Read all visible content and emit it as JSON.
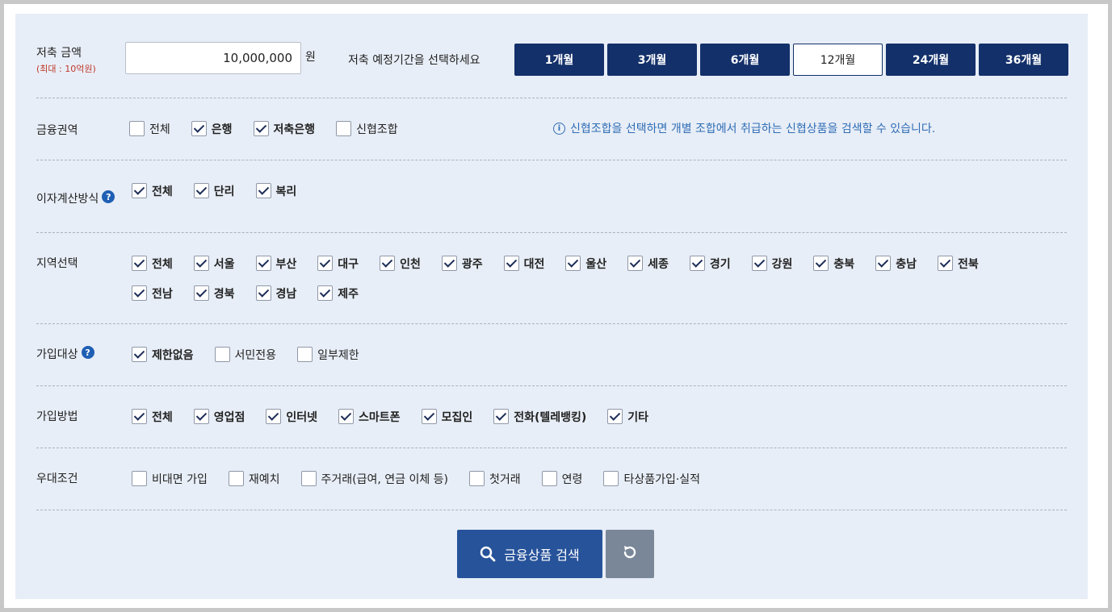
{
  "amount": {
    "label": "저축 금액",
    "sublabel": "(최대 : 10억원)",
    "value": "10,000,000",
    "unit": "원"
  },
  "period": {
    "label": "저축 예정기간을 선택하세요",
    "options": [
      "1개월",
      "3개월",
      "6개월",
      "12개월",
      "24개월",
      "36개월"
    ],
    "selected": "12개월"
  },
  "sector": {
    "label": "금융권역",
    "options": [
      {
        "label": "전체",
        "checked": false
      },
      {
        "label": "은행",
        "checked": true
      },
      {
        "label": "저축은행",
        "checked": true
      },
      {
        "label": "신협조합",
        "checked": false
      }
    ],
    "info": "신협조합을 선택하면 개별 조합에서 취급하는 신협상품을 검색할 수 있습니다."
  },
  "interest": {
    "label": "이자계산방식",
    "options": [
      {
        "label": "전체",
        "checked": true
      },
      {
        "label": "단리",
        "checked": true
      },
      {
        "label": "복리",
        "checked": true
      }
    ]
  },
  "region": {
    "label": "지역선택",
    "options": [
      {
        "label": "전체",
        "checked": true
      },
      {
        "label": "서울",
        "checked": true
      },
      {
        "label": "부산",
        "checked": true
      },
      {
        "label": "대구",
        "checked": true
      },
      {
        "label": "인천",
        "checked": true
      },
      {
        "label": "광주",
        "checked": true
      },
      {
        "label": "대전",
        "checked": true
      },
      {
        "label": "울산",
        "checked": true
      },
      {
        "label": "세종",
        "checked": true
      },
      {
        "label": "경기",
        "checked": true
      },
      {
        "label": "강원",
        "checked": true
      },
      {
        "label": "충북",
        "checked": true
      },
      {
        "label": "충남",
        "checked": true
      },
      {
        "label": "전북",
        "checked": true
      },
      {
        "label": "전남",
        "checked": true
      },
      {
        "label": "경북",
        "checked": true
      },
      {
        "label": "경남",
        "checked": true
      },
      {
        "label": "제주",
        "checked": true
      }
    ]
  },
  "target": {
    "label": "가입대상",
    "options": [
      {
        "label": "제한없음",
        "checked": true
      },
      {
        "label": "서민전용",
        "checked": false
      },
      {
        "label": "일부제한",
        "checked": false
      }
    ]
  },
  "method": {
    "label": "가입방법",
    "options": [
      {
        "label": "전체",
        "checked": true
      },
      {
        "label": "영업점",
        "checked": true
      },
      {
        "label": "인터넷",
        "checked": true
      },
      {
        "label": "스마트폰",
        "checked": true
      },
      {
        "label": "모집인",
        "checked": true
      },
      {
        "label": "전화(텔레뱅킹)",
        "checked": true
      },
      {
        "label": "기타",
        "checked": true
      }
    ]
  },
  "preferential": {
    "label": "우대조건",
    "options": [
      {
        "label": "비대면 가입",
        "checked": false
      },
      {
        "label": "재예치",
        "checked": false
      },
      {
        "label": "주거래(급여, 연금 이체 등)",
        "checked": false
      },
      {
        "label": "첫거래",
        "checked": false
      },
      {
        "label": "연령",
        "checked": false
      },
      {
        "label": "타상품가입·실적",
        "checked": false
      }
    ]
  },
  "actions": {
    "search_label": "금융상품 검색"
  },
  "icons": {
    "help": "question-circle-icon",
    "info": "info-circle-icon",
    "search": "search-icon",
    "reset": "reset-icon"
  },
  "colors": {
    "primary": "#13306a",
    "search_button": "#27539a",
    "reset_button": "#7a8799",
    "info_text": "#2f6db5",
    "panel_bg": "#e8eef7"
  }
}
